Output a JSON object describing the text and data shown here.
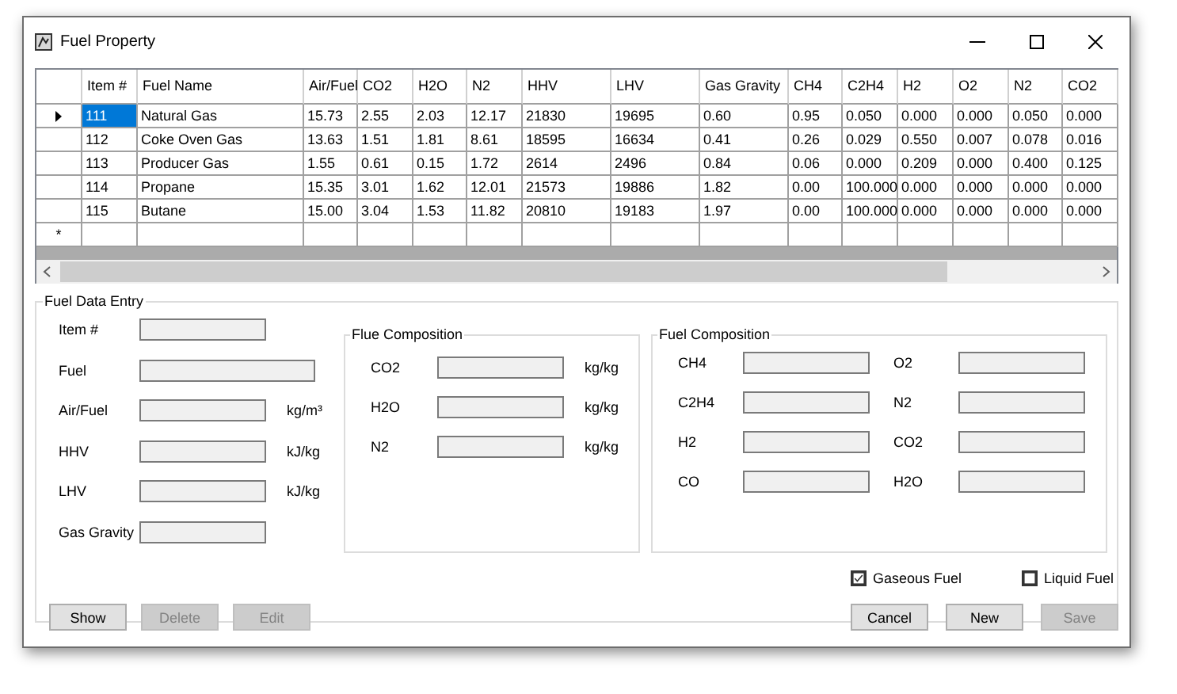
{
  "window": {
    "title": "Fuel Property"
  },
  "grid": {
    "columns": [
      "Item #",
      "Fuel Name",
      "Air/Fuel",
      "CO2",
      "H2O",
      "N2",
      "HHV",
      "LHV",
      "Gas Gravity",
      "CH4",
      "C2H4",
      "H2",
      "O2",
      "N2",
      "CO2"
    ],
    "rows": [
      {
        "selected": true,
        "cells": [
          "111",
          "Natural Gas",
          "15.73",
          "2.55",
          "2.03",
          "12.17",
          "21830",
          "19695",
          "0.60",
          "0.95",
          "0.050",
          "0.000",
          "0.000",
          "0.050",
          "0.000"
        ]
      },
      {
        "selected": false,
        "cells": [
          "112",
          "Coke Oven Gas",
          "13.63",
          "1.51",
          "1.81",
          "8.61",
          "18595",
          "16634",
          "0.41",
          "0.26",
          "0.029",
          "0.550",
          "0.007",
          "0.078",
          "0.016"
        ]
      },
      {
        "selected": false,
        "cells": [
          "113",
          "Producer Gas",
          "1.55",
          "0.61",
          "0.15",
          "1.72",
          "2614",
          "2496",
          "0.84",
          "0.06",
          "0.000",
          "0.209",
          "0.000",
          "0.400",
          "0.125"
        ]
      },
      {
        "selected": false,
        "cells": [
          "114",
          "Propane",
          "15.35",
          "3.01",
          "1.62",
          "12.01",
          "21573",
          "19886",
          "1.82",
          "0.00",
          "100.000",
          "0.000",
          "0.000",
          "0.000",
          "0.000"
        ]
      },
      {
        "selected": false,
        "cells": [
          "115",
          "Butane",
          "15.00",
          "3.04",
          "1.53",
          "11.82",
          "20810",
          "19183",
          "1.97",
          "0.00",
          "100.000",
          "0.000",
          "0.000",
          "0.000",
          "0.000"
        ]
      }
    ],
    "new_row_marker": "*"
  },
  "entry": {
    "title": "Fuel Data Entry",
    "fields": [
      {
        "label": "Item #",
        "kind": "short"
      },
      {
        "label": "Fuel",
        "kind": "wide"
      },
      {
        "label": "Air/Fuel",
        "kind": "short",
        "unit": "kg/m³"
      },
      {
        "label": "HHV",
        "kind": "short",
        "unit": "kJ/kg"
      },
      {
        "label": "LHV",
        "kind": "short",
        "unit": "kJ/kg"
      },
      {
        "label": "Gas Gravity",
        "kind": "short"
      }
    ],
    "flue": {
      "title": "Flue Composition",
      "fields": [
        {
          "label": "CO2",
          "unit": "kg/kg"
        },
        {
          "label": "H2O",
          "unit": "kg/kg"
        },
        {
          "label": "N2",
          "unit": "kg/kg"
        }
      ]
    },
    "fuel": {
      "title": "Fuel Composition",
      "fields": [
        "CH4",
        "O2",
        "C2H4",
        "N2",
        "H2",
        "CO2",
        "CO",
        "H2O"
      ]
    },
    "checkboxes": [
      {
        "label": "Gaseous Fuel",
        "checked": true
      },
      {
        "label": "Liquid Fuel",
        "checked": false
      }
    ],
    "left_buttons": [
      {
        "label": "Show",
        "disabled": false
      },
      {
        "label": "Delete",
        "disabled": true
      },
      {
        "label": "Edit",
        "disabled": true
      }
    ],
    "right_buttons": [
      {
        "label": "Cancel",
        "disabled": false
      },
      {
        "label": "New",
        "disabled": false
      },
      {
        "label": "Save",
        "disabled": true
      }
    ]
  }
}
